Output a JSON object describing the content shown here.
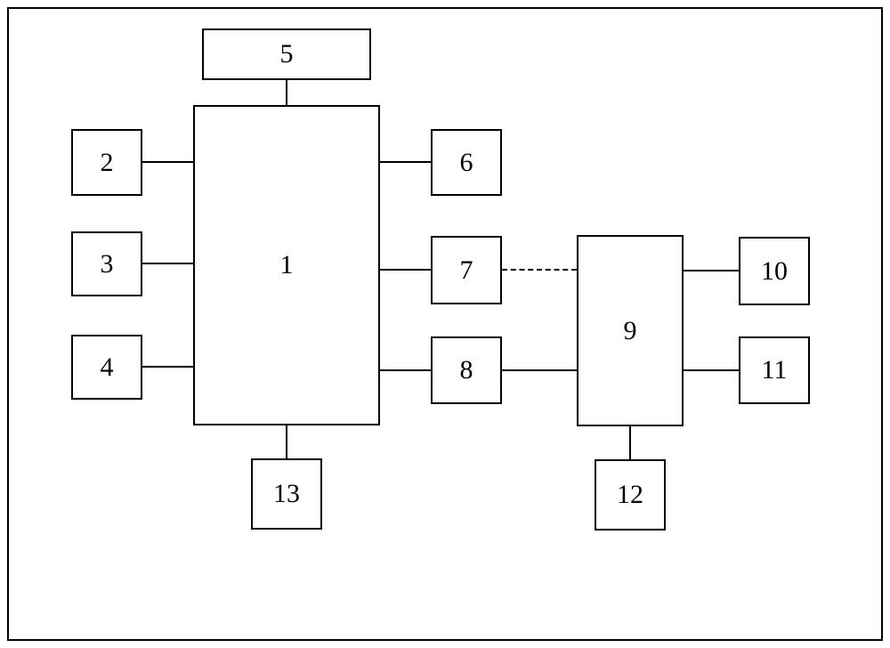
{
  "blocks": {
    "b1": "1",
    "b2": "2",
    "b3": "3",
    "b4": "4",
    "b5": "5",
    "b6": "6",
    "b7": "7",
    "b8": "8",
    "b9": "9",
    "b10": "10",
    "b11": "11",
    "b12": "12",
    "b13": "13"
  }
}
